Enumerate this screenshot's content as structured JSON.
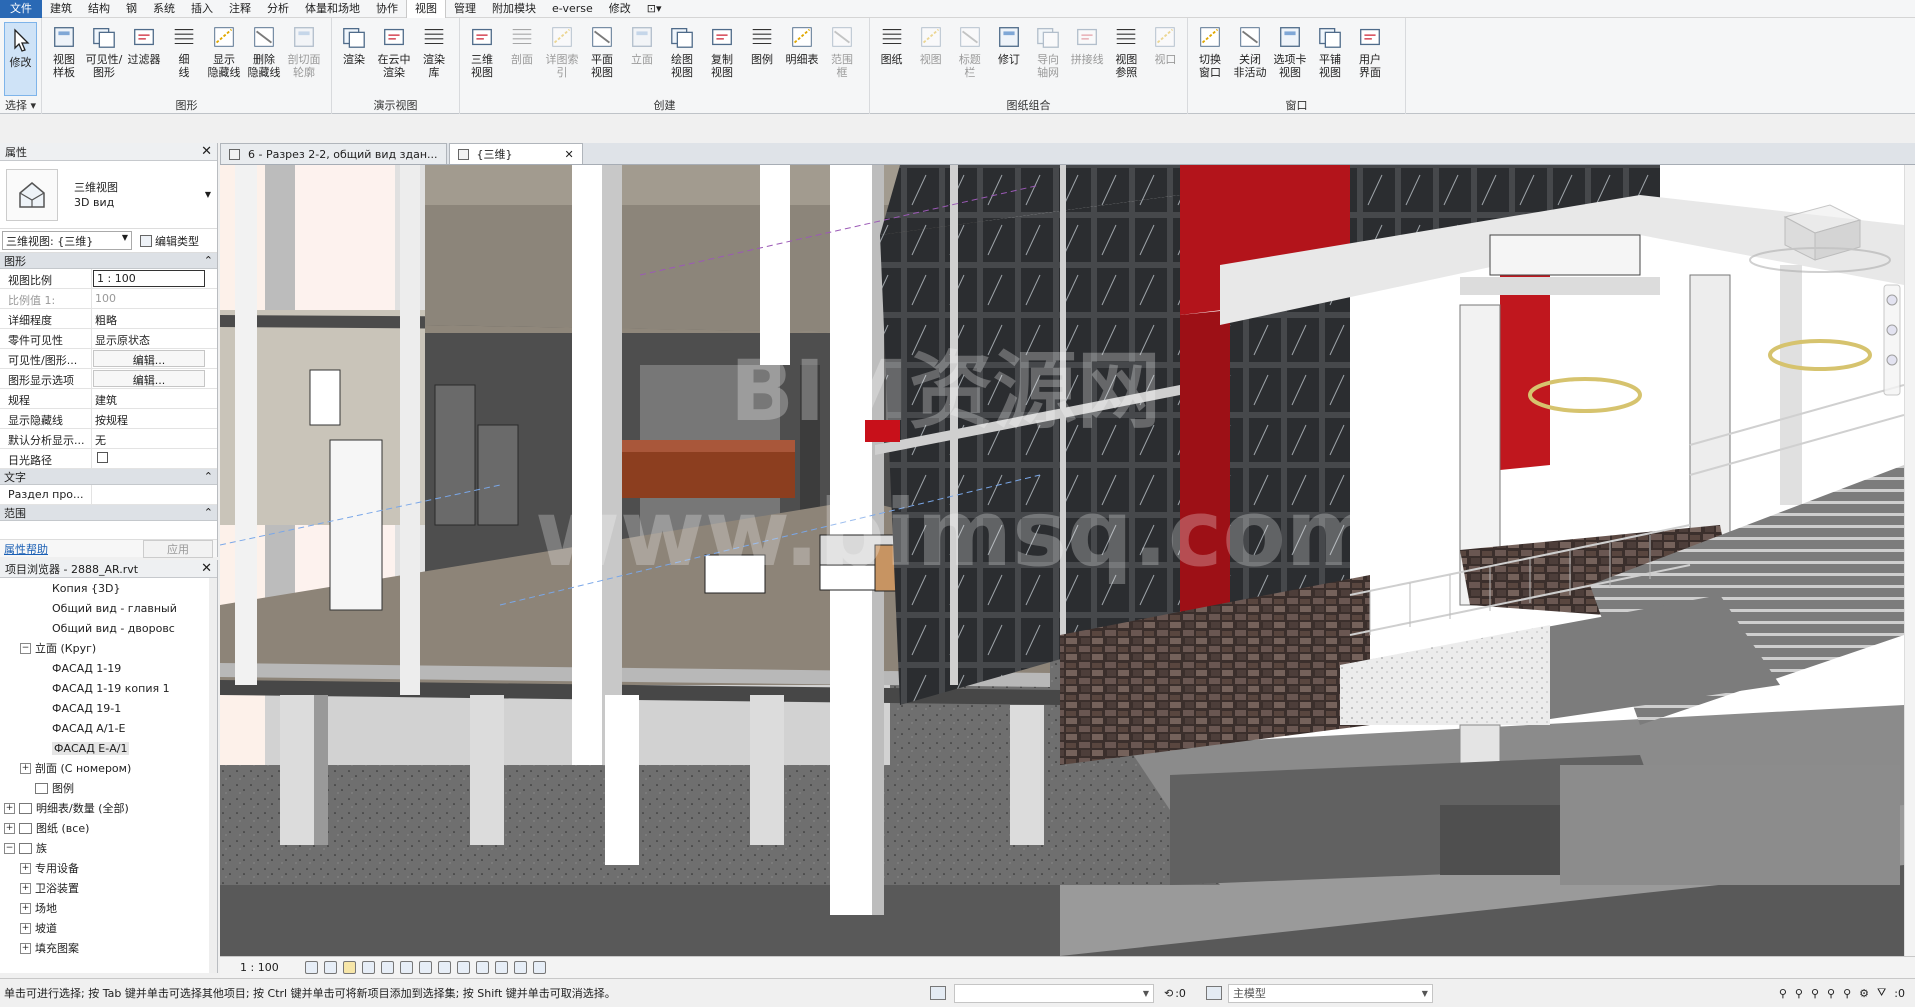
{
  "menu": {
    "tabs": [
      "文件",
      "建筑",
      "结构",
      "钢",
      "系统",
      "插入",
      "注释",
      "分析",
      "体量和场地",
      "协作",
      "视图",
      "管理",
      "附加模块",
      "e-verse",
      "修改",
      "⊡▾"
    ],
    "active": "视图"
  },
  "ribbon": {
    "select": {
      "label": "修改",
      "group": "选择 ▾"
    },
    "graphics": {
      "label": "图形",
      "tools": [
        "视图\n样板",
        "可见性/\n图形",
        "过滤器",
        "细\n线",
        "显示\n隐藏线",
        "删除\n隐藏线",
        "剖切面\n轮廓"
      ]
    },
    "presentation": {
      "label": "演示视图",
      "tools": [
        "渲染",
        "在云中\n渲染",
        "渲染\n库"
      ]
    },
    "create": {
      "label": "创建",
      "tools": [
        "三维\n视图",
        "剖面",
        "详图索引",
        "平面\n视图",
        "立面",
        "绘图\n视图",
        "复制\n视图",
        "图例",
        "明细表",
        "范围\n框"
      ]
    },
    "sheet": {
      "label": "图纸组合",
      "tools": [
        "图纸",
        "视图",
        "标题\n栏",
        "修订",
        "导向\n轴网",
        "拼接线",
        "视图\n参照",
        "视口"
      ]
    },
    "windows": {
      "label": "窗口",
      "tools": [
        "切换\n窗口",
        "关闭\n非活动",
        "选项卡\n视图",
        "平铺\n视图",
        "用户\n界面"
      ]
    }
  },
  "properties": {
    "title": "属性",
    "type_line1": "三维视图",
    "type_line2": "3D вид",
    "selector": "三维视图: {三维}",
    "edit_type": "编辑类型",
    "cat_graphics": "图形",
    "rows": [
      {
        "name": "视图比例",
        "value": "1 : 100"
      },
      {
        "name": "比例值 1:",
        "value": "100"
      },
      {
        "name": "详细程度",
        "value": "粗略"
      },
      {
        "name": "零件可见性",
        "value": "显示原状态"
      },
      {
        "name": "可见性/图形...",
        "value": "编辑..."
      },
      {
        "name": "图形显示选项",
        "value": "编辑..."
      },
      {
        "name": "规程",
        "value": "建筑"
      },
      {
        "name": "显示隐藏线",
        "value": "按规程"
      },
      {
        "name": "默认分析显示...",
        "value": "无"
      },
      {
        "name": "日光路径",
        "value": ""
      }
    ],
    "cat_text": "文字",
    "text_row": {
      "name": "Раздел про...",
      "value": ""
    },
    "cat_range": "范围",
    "help_link": "属性帮助",
    "apply": "应用"
  },
  "browser": {
    "title": "项目浏览器 - 2888_AR.rvt",
    "items": [
      {
        "label": "Копия {3D}",
        "indent": 52,
        "exp": "",
        "icon": false
      },
      {
        "label": "Общий вид - главный",
        "indent": 52,
        "exp": "",
        "icon": false
      },
      {
        "label": "Общий вид - дворовс",
        "indent": 52,
        "exp": "",
        "icon": false
      },
      {
        "label": "立面 (Круг)",
        "indent": 20,
        "exp": "−",
        "icon": false
      },
      {
        "label": "ФАСАД 1-19",
        "indent": 52,
        "exp": "",
        "icon": false
      },
      {
        "label": "ФАСАД 1-19 копия 1",
        "indent": 52,
        "exp": "",
        "icon": false
      },
      {
        "label": "ФАСАД 19-1",
        "indent": 52,
        "exp": "",
        "icon": false
      },
      {
        "label": "ФАСАД А/1-Е",
        "indent": 52,
        "exp": "",
        "icon": false
      },
      {
        "label": "ФАСАД Е-А/1",
        "indent": 52,
        "exp": "",
        "icon": false,
        "selected": true
      },
      {
        "label": "剖面 (С номером)",
        "indent": 20,
        "exp": "+",
        "icon": false
      },
      {
        "label": "图例",
        "indent": 20,
        "exp": "",
        "icon": true
      },
      {
        "label": "明细表/数量 (全部)",
        "indent": 4,
        "exp": "+",
        "icon": true
      },
      {
        "label": "图纸 (все)",
        "indent": 4,
        "exp": "+",
        "icon": true
      },
      {
        "label": "族",
        "indent": 4,
        "exp": "−",
        "icon": true
      },
      {
        "label": "专用设备",
        "indent": 20,
        "exp": "+",
        "icon": false
      },
      {
        "label": "卫浴装置",
        "indent": 20,
        "exp": "+",
        "icon": false
      },
      {
        "label": "场地",
        "indent": 20,
        "exp": "+",
        "icon": false
      },
      {
        "label": "坡道",
        "indent": 20,
        "exp": "+",
        "icon": false
      },
      {
        "label": "填充图案",
        "indent": 20,
        "exp": "+",
        "icon": false
      }
    ]
  },
  "viewtabs": [
    {
      "label": "6 - Разрез 2-2, общий вид здан...",
      "active": false
    },
    {
      "label": "{三维}",
      "active": true
    }
  ],
  "viewport": {
    "watermark1": "BIM资源网",
    "watermark2": "www.bimsq.com"
  },
  "viewbar": {
    "scale": "1 : 100"
  },
  "status": {
    "message": "单击可进行选择; 按 Tab 键并单击可选择其他项目; 按 Ctrl 键并单击可将新项目添加到选择集; 按 Shift 键并单击可取消选择。",
    "count": ":0",
    "model": "主模型",
    "filter": ":0"
  },
  "colors": {
    "accent": "#2a69b5",
    "facade_red": "#b3141b",
    "floor": "#8d8478"
  }
}
